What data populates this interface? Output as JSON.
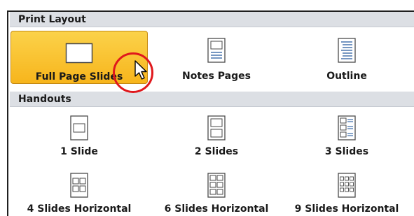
{
  "print_layout": {
    "header": "Print Layout",
    "items": [
      {
        "label": "Full Page Slides",
        "icon": "full-page-slide-icon",
        "selected": true
      },
      {
        "label": "Notes Pages",
        "icon": "notes-page-icon"
      },
      {
        "label": "Outline",
        "icon": "outline-page-icon"
      }
    ]
  },
  "handouts": {
    "header": "Handouts",
    "items": [
      {
        "label": "1 Slide",
        "icon": "handout-1-slide-icon"
      },
      {
        "label": "2 Slides",
        "icon": "handout-2-slides-icon"
      },
      {
        "label": "3 Slides",
        "icon": "handout-3-slides-icon"
      },
      {
        "label": "4 Slides Horizontal",
        "icon": "handout-4-slides-icon"
      },
      {
        "label": "6 Slides Horizontal",
        "icon": "handout-6-slides-icon"
      },
      {
        "label": "9 Slides Horizontal",
        "icon": "handout-9-slides-icon"
      }
    ]
  },
  "colors": {
    "selected_fill": "#f7b51c",
    "highlight_ring": "#e0181c",
    "header_bg": "#dcdfe4"
  }
}
